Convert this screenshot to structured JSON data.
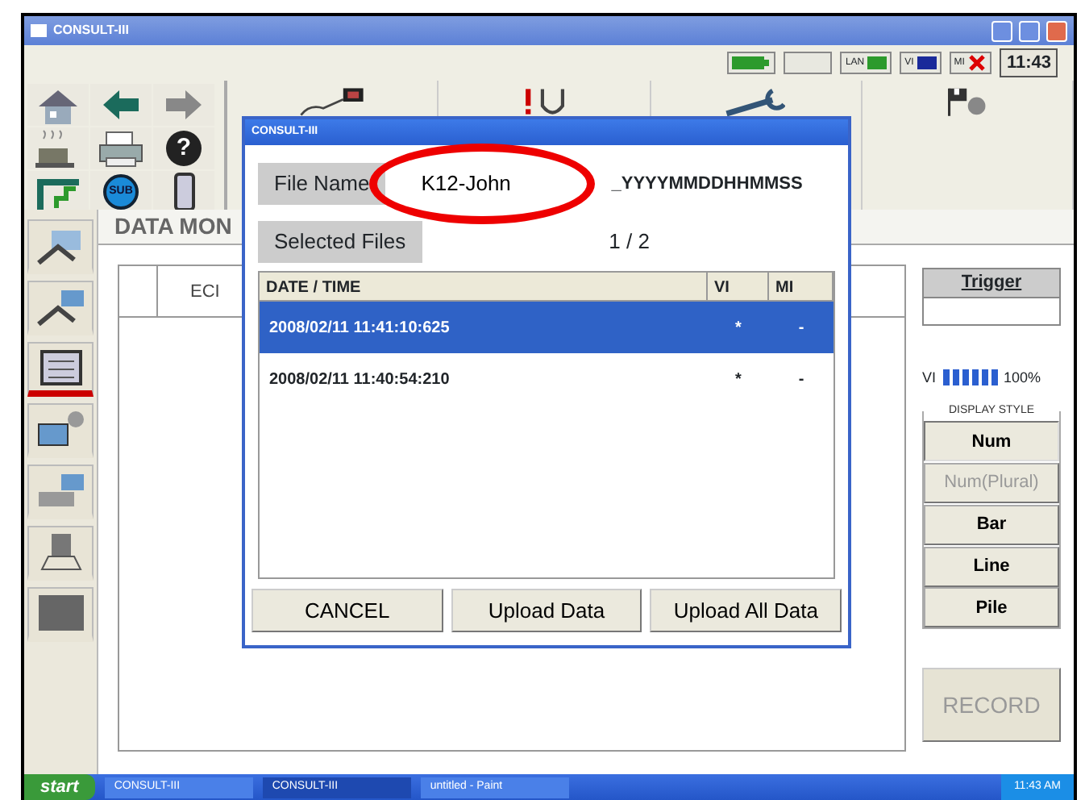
{
  "window": {
    "title": "CONSULT-III"
  },
  "status_bar": {
    "indicators": [
      {
        "label": "LAN"
      },
      {
        "label": "VI"
      },
      {
        "label": "MI"
      }
    ],
    "clock": "11:43"
  },
  "toolbar": {
    "sub_label": "SUB",
    "help_glyph": "?"
  },
  "sidebar": {
    "items": [
      {
        "selected": false
      },
      {
        "selected": false
      },
      {
        "selected": true
      },
      {
        "selected": false
      },
      {
        "selected": false
      },
      {
        "selected": false
      },
      {
        "selected": false
      }
    ]
  },
  "screen": {
    "tab": "DATA MON",
    "table_column": "ECI",
    "trigger": "Trigger",
    "vi": {
      "label": "VI",
      "level": 1,
      "reading": "100%"
    },
    "display_style": {
      "title": "DISPLAY STYLE",
      "buttons": [
        {
          "label": "Num",
          "selected": true,
          "disabled": false
        },
        {
          "label": "Num(Plural)",
          "selected": false,
          "disabled": true
        },
        {
          "label": "Bar",
          "selected": false,
          "disabled": false
        },
        {
          "label": "Line",
          "selected": false,
          "disabled": false
        },
        {
          "label": "Pile",
          "selected": false,
          "disabled": false
        }
      ]
    },
    "record": {
      "label": "RECORD",
      "disabled": true
    }
  },
  "dialog": {
    "title": "CONSULT-III",
    "file_name_label": "File Name",
    "file_name": {
      "value": "K12-John",
      "highlighted": true
    },
    "file_name_suffix": "_YYYYMMDDHHMMSS",
    "selected_files_label": "Selected Files",
    "selected_files": "1 / 2",
    "table": {
      "columns": [
        "DATE / TIME",
        "VI",
        "MI"
      ],
      "rows": [
        {
          "cells": [
            "2008/02/11 11:41:10:625",
            "*",
            "-"
          ],
          "selected": true
        },
        {
          "cells": [
            "2008/02/11 11:40:54:210",
            "*",
            "-"
          ],
          "selected": false
        }
      ]
    },
    "buttons": [
      "CANCEL",
      "Upload Data",
      "Upload All Data"
    ]
  },
  "taskbar": {
    "start": "start",
    "tasks": [
      {
        "label": "CONSULT-III",
        "selected": false
      },
      {
        "label": "CONSULT-III",
        "selected": true
      },
      {
        "label": "untitled - Paint",
        "selected": false
      }
    ],
    "clock": "11:43 AM"
  }
}
